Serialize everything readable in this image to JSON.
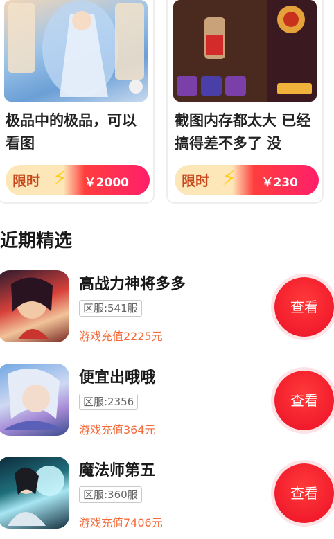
{
  "cards": [
    {
      "title": "极品中的极品，可以看图",
      "tag": "限时",
      "price": "￥2000",
      "image": "fantasy-heroine-screenshot"
    },
    {
      "title": "截图内存都太大 已经搞得差不多了 没",
      "tag": "限时",
      "price": "￥230",
      "image": "fighter-game-screenshot"
    }
  ],
  "section_title": "近期精选",
  "items": [
    {
      "name": "高战力神将多多",
      "server": "区服:541服",
      "recharge": "游戏充值2225元",
      "button": "查看",
      "icon": "warrior-avatar"
    },
    {
      "name": "便宜出哦哦",
      "server": "区服:2356",
      "recharge": "游戏充值364元",
      "button": "查看",
      "icon": "fairy-avatar"
    },
    {
      "name": "魔法师第五",
      "server": "区服:360服",
      "recharge": "游戏充值7406元",
      "button": "查看",
      "icon": "mage-avatar"
    }
  ],
  "colors": {
    "accent": "#f21c2c",
    "recharge_text": "#f46b3b",
    "tag_text": "#c6471c"
  }
}
